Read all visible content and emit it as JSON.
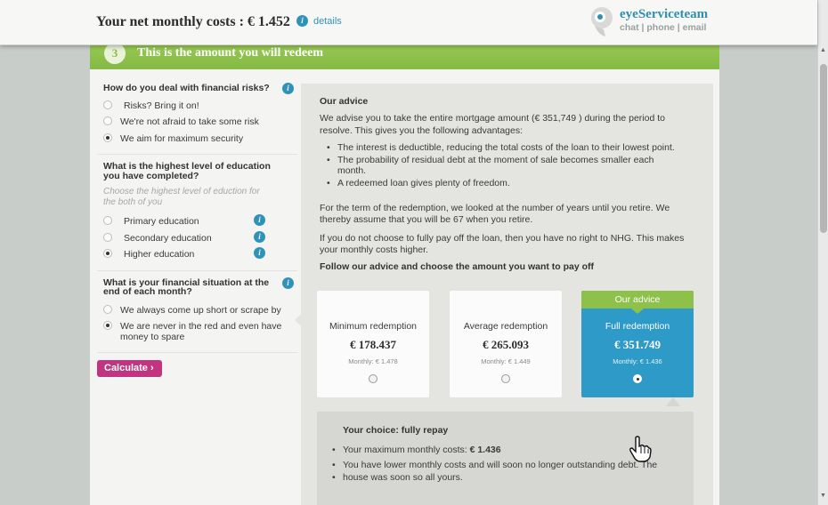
{
  "header": {
    "net_costs_label": "Your net monthly costs : € 1.452",
    "details_link": "details",
    "brand_name": "eyeServiceteam",
    "brand_sub": "chat | phone | email"
  },
  "step": {
    "number": "3",
    "title": "This is the amount you will redeem"
  },
  "form": {
    "q1": {
      "question": "How do you deal with financial risks?",
      "options": [
        "Risks? Bring it on!",
        "We're not afraid to take some risk",
        "We aim for maximum security"
      ],
      "selected": 2
    },
    "q2": {
      "question_line1": "What is the highest level of education",
      "question_line2": "you have completed?",
      "hint_line1": "Choose the highest level of eduction for",
      "hint_line2": "the both of you",
      "options": [
        "Primary education",
        "Secondary education",
        "Higher education"
      ],
      "selected": 2
    },
    "q3": {
      "question_line1": "What is your financial situation at the",
      "question_line2": "end of each month?",
      "options": [
        "We always come up short or scrape by",
        "We are never in the red and even have",
        "money to spare"
      ],
      "selected": 1
    },
    "calculate_label": "Calculate"
  },
  "advice": {
    "title": "Our advice",
    "p1_line1": "We advise you to take the entire mortgage amount (€ 351,749 ) during the period to",
    "p1_line2": "resolve. This gives you the following advantages:",
    "bullets": [
      "The interest is deductible, reducing the total costs of the loan to their lowest point.",
      "The probability of residual debt at the moment of sale becomes smaller each",
      "month.",
      "A redeemed loan gives plenty of freedom."
    ],
    "p2_line1": "For the term of the redemption, we looked at the number of years until you retire. We",
    "p2_line2": "thereby assume that you will be 67 when you retire.",
    "p3_line1": "If you do not choose to fully pay off the loan, then you have no right to NHG. This makes",
    "p3_line2": "your monthly costs higher.",
    "follow": "Follow our advice and choose the amount you want to pay off"
  },
  "options": [
    {
      "label": "Minimum redemption",
      "amount": "€ 178.437",
      "monthly": "Monthly: € 1.478",
      "selected": false
    },
    {
      "label": "Average redemption",
      "amount": "€ 265.093",
      "monthly": "Monthly: € 1.449",
      "selected": false
    },
    {
      "label": "Full redemption",
      "amount": "€ 351.749",
      "monthly": "Monthly: € 1.436",
      "selected": true,
      "tag": "Our advice"
    }
  ],
  "choice": {
    "title": "Your choice: fully repay",
    "b1_text": "Your maximum monthly costs: ",
    "b1_value": "€ 1.436",
    "b2_line1": "You have lower monthly costs and will soon no longer outstanding debt. The",
    "b2_line2": "house was soon so all yours."
  },
  "colors": {
    "green": "#8bc34a",
    "blue": "#2e9ac7",
    "magenta": "#c2347f"
  }
}
